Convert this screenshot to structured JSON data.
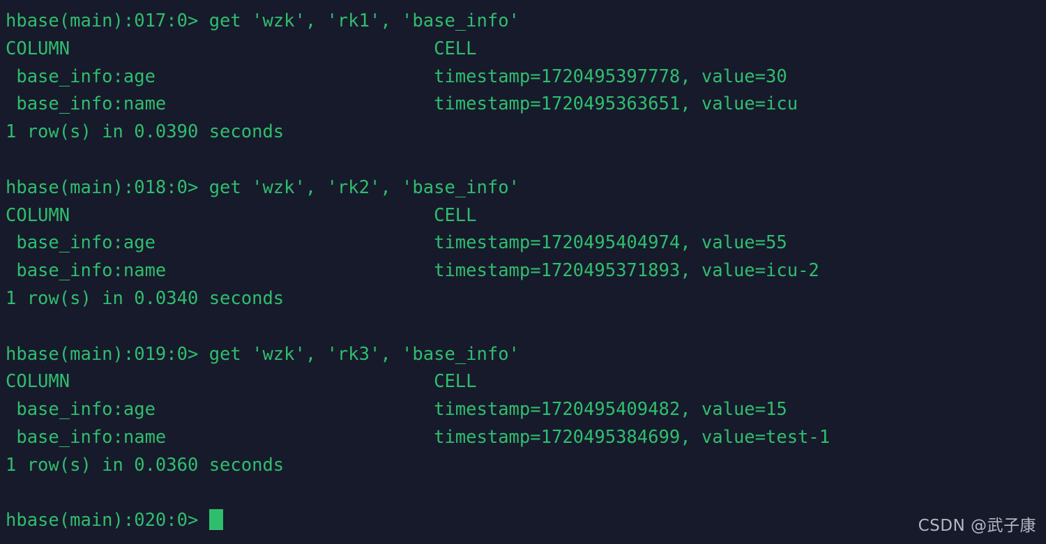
{
  "terminal": {
    "shell": "hbase shell",
    "background_color": "#171a2b",
    "text_color": "#2fbe6e",
    "cursor_color": "#2fbe6e",
    "column_header": "COLUMN",
    "cell_header": "CELL",
    "lines": [
      "hbase(main):017:0> get 'wzk', 'rk1', 'base_info'",
      "COLUMN                                  CELL",
      " base_info:age                          timestamp=1720495397778, value=30",
      " base_info:name                         timestamp=1720495363651, value=icu",
      "1 row(s) in 0.0390 seconds",
      "",
      "hbase(main):018:0> get 'wzk', 'rk2', 'base_info'",
      "COLUMN                                  CELL",
      " base_info:age                          timestamp=1720495404974, value=55",
      " base_info:name                         timestamp=1720495371893, value=icu-2",
      "1 row(s) in 0.0340 seconds",
      "",
      "hbase(main):019:0> get 'wzk', 'rk3', 'base_info'",
      "COLUMN                                  CELL",
      " base_info:age                          timestamp=1720495409482, value=15",
      " base_info:name                         timestamp=1720495384699, value=test-1",
      "1 row(s) in 0.0360 seconds",
      ""
    ],
    "blocks": [
      {
        "prompt": "hbase(main):017:0>",
        "command": "get 'wzk', 'rk1', 'base_info'",
        "table": "wzk",
        "rowkey": "rk1",
        "column_family": "base_info",
        "rows": [
          {
            "column": "base_info:age",
            "timestamp": "1720495397778",
            "value": "30"
          },
          {
            "column": "base_info:name",
            "timestamp": "1720495363651",
            "value": "icu"
          }
        ],
        "result": "1 row(s) in 0.0390 seconds",
        "row_count": "1",
        "elapsed_seconds": "0.0390"
      },
      {
        "prompt": "hbase(main):018:0>",
        "command": "get 'wzk', 'rk2', 'base_info'",
        "table": "wzk",
        "rowkey": "rk2",
        "column_family": "base_info",
        "rows": [
          {
            "column": "base_info:age",
            "timestamp": "1720495404974",
            "value": "55"
          },
          {
            "column": "base_info:name",
            "timestamp": "1720495371893",
            "value": "icu-2"
          }
        ],
        "result": "1 row(s) in 0.0340 seconds",
        "row_count": "1",
        "elapsed_seconds": "0.0340"
      },
      {
        "prompt": "hbase(main):019:0>",
        "command": "get 'wzk', 'rk3', 'base_info'",
        "table": "wzk",
        "rowkey": "rk3",
        "column_family": "base_info",
        "rows": [
          {
            "column": "base_info:age",
            "timestamp": "1720495409482",
            "value": "15"
          },
          {
            "column": "base_info:name",
            "timestamp": "1720495384699",
            "value": "test-1"
          }
        ],
        "result": "1 row(s) in 0.0360 seconds",
        "row_count": "1",
        "elapsed_seconds": "0.0360"
      }
    ],
    "active_prompt": "hbase(main):020:0> ",
    "cursor": "block"
  },
  "watermark": {
    "text": "CSDN @武子康",
    "color": "#c2c6cf"
  }
}
